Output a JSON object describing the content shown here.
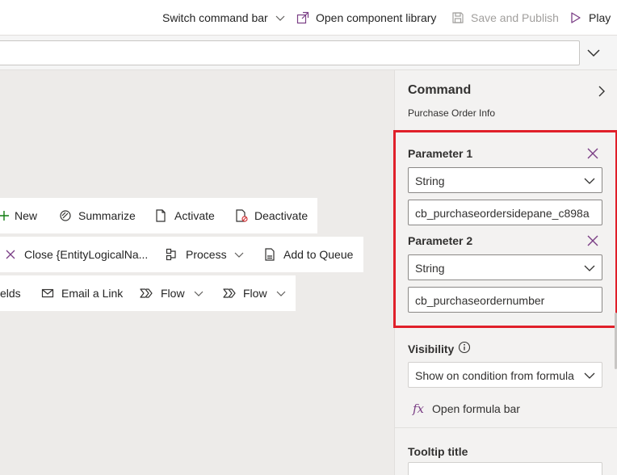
{
  "toolbar": {
    "switch_command_bar": "Switch command bar",
    "open_component_library": "Open component library",
    "save_and_publish": "Save and Publish",
    "play": "Play"
  },
  "canvas": {
    "row1": [
      "New",
      "Summarize",
      "Activate",
      "Deactivate"
    ],
    "row2": [
      "Close {EntityLogicalNa...",
      "Process",
      "Add to Queue"
    ],
    "row3": [
      "elds",
      "Email a Link",
      "Flow",
      "Flow"
    ]
  },
  "pane": {
    "title": "Command",
    "subtitle": "Purchase Order Info",
    "param1": {
      "label": "Parameter 1",
      "type": "String",
      "value": "cb_purchaseordersidepane_c898a"
    },
    "param2": {
      "label": "Parameter 2",
      "type": "String",
      "value": "cb_purchaseordernumber"
    },
    "visibility": {
      "label": "Visibility",
      "value": "Show on condition from formula"
    },
    "open_formula_bar": "Open formula bar",
    "fx": "fx",
    "tooltip_title": "Tooltip title"
  },
  "colors": {
    "highlight": "#e0202a",
    "accent_purple": "#7a3e85",
    "canvas_bg": "#edebe9",
    "pane_bg": "#f3f2f1"
  }
}
